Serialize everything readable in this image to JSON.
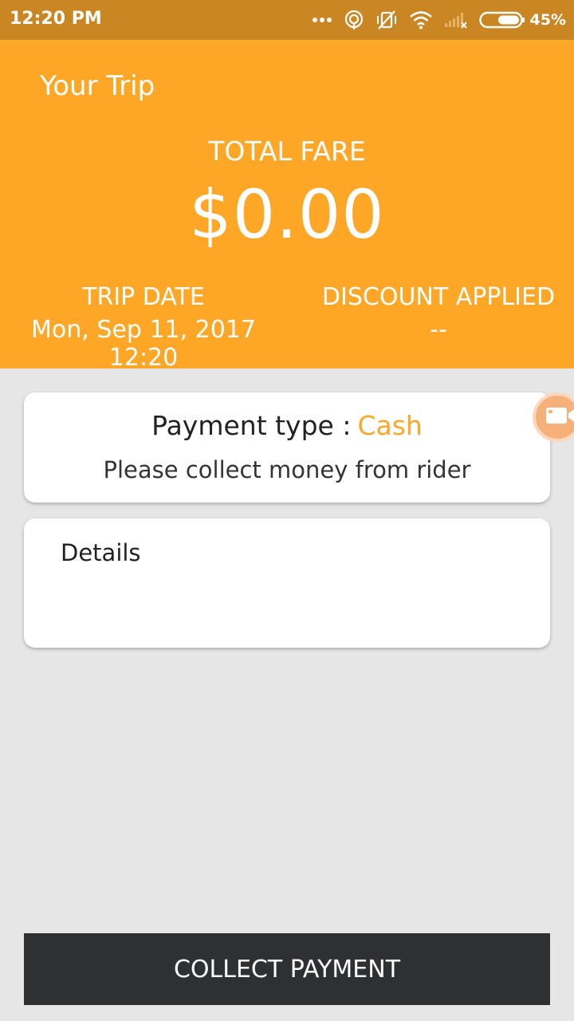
{
  "status_bar": {
    "time": "12:20 PM",
    "battery_percent": "45%",
    "icons": [
      "more-dots-icon",
      "hotspot-icon",
      "vibrate-off-icon",
      "wifi-icon",
      "signal-icon",
      "battery-icon"
    ]
  },
  "header": {
    "title": "Your Trip",
    "fare_label": "TOTAL FARE",
    "fare_amount": "$0.00",
    "trip_date_label": "TRIP DATE",
    "trip_date_value": "Mon, Sep 11, 2017 12:20",
    "discount_label": "DISCOUNT APPLIED",
    "discount_value": "--"
  },
  "payment_card": {
    "label": "Payment type :",
    "value": "Cash",
    "note": "Please collect money from rider"
  },
  "details_card": {
    "title": "Details"
  },
  "floating_bubble": {
    "icon": "video-camera-icon"
  },
  "collect_button": {
    "label": "COLLECT PAYMENT"
  },
  "colors": {
    "header": "#fea726",
    "status_bar": "#c98622",
    "background": "#e6e6e6",
    "accent": "#fea726",
    "button": "#2e3032"
  }
}
